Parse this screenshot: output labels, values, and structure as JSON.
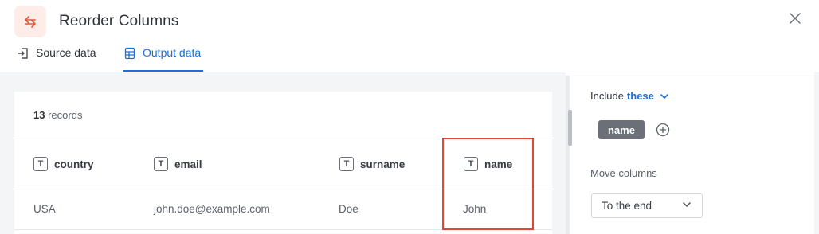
{
  "header": {
    "title": "Reorder Columns",
    "app_icon": "swap-arrows-icon",
    "accent_color": "#e8553a",
    "close_icon": "close-icon"
  },
  "tabs": [
    {
      "label": "Source data",
      "icon": "import-icon",
      "active": false
    },
    {
      "label": "Output data",
      "icon": "table-icon",
      "active": true
    }
  ],
  "output": {
    "records_count": "13",
    "records_label": "records",
    "columns": [
      {
        "label": "country",
        "type_icon": "text-type-icon",
        "type_letter": "T"
      },
      {
        "label": "email",
        "type_icon": "text-type-icon",
        "type_letter": "T"
      },
      {
        "label": "surname",
        "type_icon": "text-type-icon",
        "type_letter": "T"
      },
      {
        "label": "name",
        "type_icon": "text-type-icon",
        "type_letter": "T"
      }
    ],
    "rows": [
      [
        "USA",
        "john.doe@example.com",
        "Doe",
        "John"
      ]
    ],
    "highlight_color": "#e0473a"
  },
  "settings": {
    "include_label": "Include",
    "include_mode": "these",
    "selected_columns": [
      "name"
    ],
    "move_columns_label": "Move columns",
    "move_option": "To the end",
    "link_color": "#1a6fd8"
  }
}
